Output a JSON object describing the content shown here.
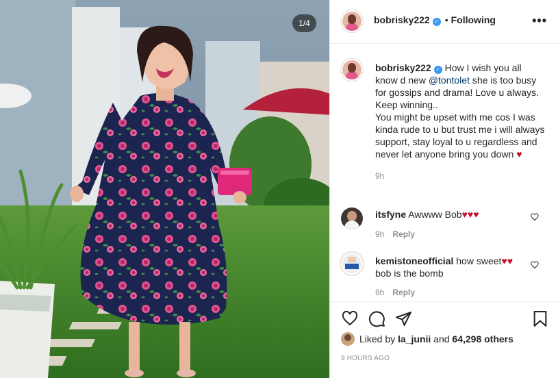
{
  "photo": {
    "counter": "1/4"
  },
  "header": {
    "username": "bobrisky222",
    "verified_mark": "✓",
    "separator": "•",
    "follow_status": "Following",
    "more_label": "•••"
  },
  "caption": {
    "username": "bobrisky222",
    "text_before": "How I wish you all know d new ",
    "mention": "@tontolet",
    "text_after": " she is too busy for gossips and drama! Love u always. Keep winning..",
    "text_2": "You might be upset with me cos I was kinda rude to u but trust me i will always support, stay loyal to u regardless and never let anyone bring you down ",
    "heart": "♥",
    "time": "9h"
  },
  "comments": [
    {
      "username": "itsfyne",
      "text": "Awwww Bob",
      "hearts": "♥♥♥",
      "time": "9h",
      "reply": "Reply"
    },
    {
      "username": "kemistoneofficial",
      "text": "how sweet",
      "hearts": "♥♥",
      "text_2": "bob is the bomb",
      "time": "8h",
      "reply": "Reply"
    }
  ],
  "actions": {
    "icons": [
      "heart-icon",
      "comment-icon",
      "share-icon",
      "bookmark-icon"
    ],
    "liked_by_prefix": "Liked by ",
    "liked_by_user": "la_junii",
    "liked_by_mid": " and ",
    "liked_by_count": "64,298 others",
    "timestamp": "9 HOURS AGO"
  },
  "colors": {
    "verified": "#3897f0",
    "mention": "#00376b",
    "heart": "#c8102e",
    "meta": "#8e8e8e"
  }
}
